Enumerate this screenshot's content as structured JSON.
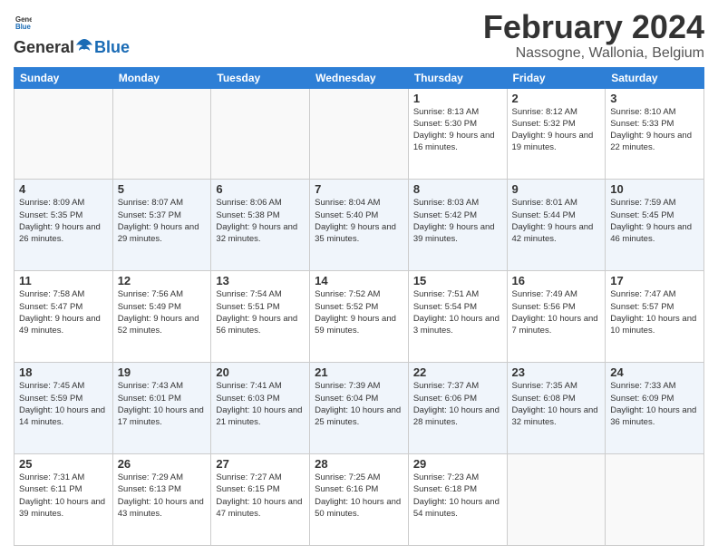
{
  "header": {
    "logo_line1": "General",
    "logo_line2": "Blue",
    "title": "February 2024",
    "subtitle": "Nassogne, Wallonia, Belgium"
  },
  "days_of_week": [
    "Sunday",
    "Monday",
    "Tuesday",
    "Wednesday",
    "Thursday",
    "Friday",
    "Saturday"
  ],
  "weeks": [
    [
      {
        "day": "",
        "info": ""
      },
      {
        "day": "",
        "info": ""
      },
      {
        "day": "",
        "info": ""
      },
      {
        "day": "",
        "info": ""
      },
      {
        "day": "1",
        "info": "Sunrise: 8:13 AM\nSunset: 5:30 PM\nDaylight: 9 hours and 16 minutes."
      },
      {
        "day": "2",
        "info": "Sunrise: 8:12 AM\nSunset: 5:32 PM\nDaylight: 9 hours and 19 minutes."
      },
      {
        "day": "3",
        "info": "Sunrise: 8:10 AM\nSunset: 5:33 PM\nDaylight: 9 hours and 22 minutes."
      }
    ],
    [
      {
        "day": "4",
        "info": "Sunrise: 8:09 AM\nSunset: 5:35 PM\nDaylight: 9 hours and 26 minutes."
      },
      {
        "day": "5",
        "info": "Sunrise: 8:07 AM\nSunset: 5:37 PM\nDaylight: 9 hours and 29 minutes."
      },
      {
        "day": "6",
        "info": "Sunrise: 8:06 AM\nSunset: 5:38 PM\nDaylight: 9 hours and 32 minutes."
      },
      {
        "day": "7",
        "info": "Sunrise: 8:04 AM\nSunset: 5:40 PM\nDaylight: 9 hours and 35 minutes."
      },
      {
        "day": "8",
        "info": "Sunrise: 8:03 AM\nSunset: 5:42 PM\nDaylight: 9 hours and 39 minutes."
      },
      {
        "day": "9",
        "info": "Sunrise: 8:01 AM\nSunset: 5:44 PM\nDaylight: 9 hours and 42 minutes."
      },
      {
        "day": "10",
        "info": "Sunrise: 7:59 AM\nSunset: 5:45 PM\nDaylight: 9 hours and 46 minutes."
      }
    ],
    [
      {
        "day": "11",
        "info": "Sunrise: 7:58 AM\nSunset: 5:47 PM\nDaylight: 9 hours and 49 minutes."
      },
      {
        "day": "12",
        "info": "Sunrise: 7:56 AM\nSunset: 5:49 PM\nDaylight: 9 hours and 52 minutes."
      },
      {
        "day": "13",
        "info": "Sunrise: 7:54 AM\nSunset: 5:51 PM\nDaylight: 9 hours and 56 minutes."
      },
      {
        "day": "14",
        "info": "Sunrise: 7:52 AM\nSunset: 5:52 PM\nDaylight: 9 hours and 59 minutes."
      },
      {
        "day": "15",
        "info": "Sunrise: 7:51 AM\nSunset: 5:54 PM\nDaylight: 10 hours and 3 minutes."
      },
      {
        "day": "16",
        "info": "Sunrise: 7:49 AM\nSunset: 5:56 PM\nDaylight: 10 hours and 7 minutes."
      },
      {
        "day": "17",
        "info": "Sunrise: 7:47 AM\nSunset: 5:57 PM\nDaylight: 10 hours and 10 minutes."
      }
    ],
    [
      {
        "day": "18",
        "info": "Sunrise: 7:45 AM\nSunset: 5:59 PM\nDaylight: 10 hours and 14 minutes."
      },
      {
        "day": "19",
        "info": "Sunrise: 7:43 AM\nSunset: 6:01 PM\nDaylight: 10 hours and 17 minutes."
      },
      {
        "day": "20",
        "info": "Sunrise: 7:41 AM\nSunset: 6:03 PM\nDaylight: 10 hours and 21 minutes."
      },
      {
        "day": "21",
        "info": "Sunrise: 7:39 AM\nSunset: 6:04 PM\nDaylight: 10 hours and 25 minutes."
      },
      {
        "day": "22",
        "info": "Sunrise: 7:37 AM\nSunset: 6:06 PM\nDaylight: 10 hours and 28 minutes."
      },
      {
        "day": "23",
        "info": "Sunrise: 7:35 AM\nSunset: 6:08 PM\nDaylight: 10 hours and 32 minutes."
      },
      {
        "day": "24",
        "info": "Sunrise: 7:33 AM\nSunset: 6:09 PM\nDaylight: 10 hours and 36 minutes."
      }
    ],
    [
      {
        "day": "25",
        "info": "Sunrise: 7:31 AM\nSunset: 6:11 PM\nDaylight: 10 hours and 39 minutes."
      },
      {
        "day": "26",
        "info": "Sunrise: 7:29 AM\nSunset: 6:13 PM\nDaylight: 10 hours and 43 minutes."
      },
      {
        "day": "27",
        "info": "Sunrise: 7:27 AM\nSunset: 6:15 PM\nDaylight: 10 hours and 47 minutes."
      },
      {
        "day": "28",
        "info": "Sunrise: 7:25 AM\nSunset: 6:16 PM\nDaylight: 10 hours and 50 minutes."
      },
      {
        "day": "29",
        "info": "Sunrise: 7:23 AM\nSunset: 6:18 PM\nDaylight: 10 hours and 54 minutes."
      },
      {
        "day": "",
        "info": ""
      },
      {
        "day": "",
        "info": ""
      }
    ]
  ]
}
